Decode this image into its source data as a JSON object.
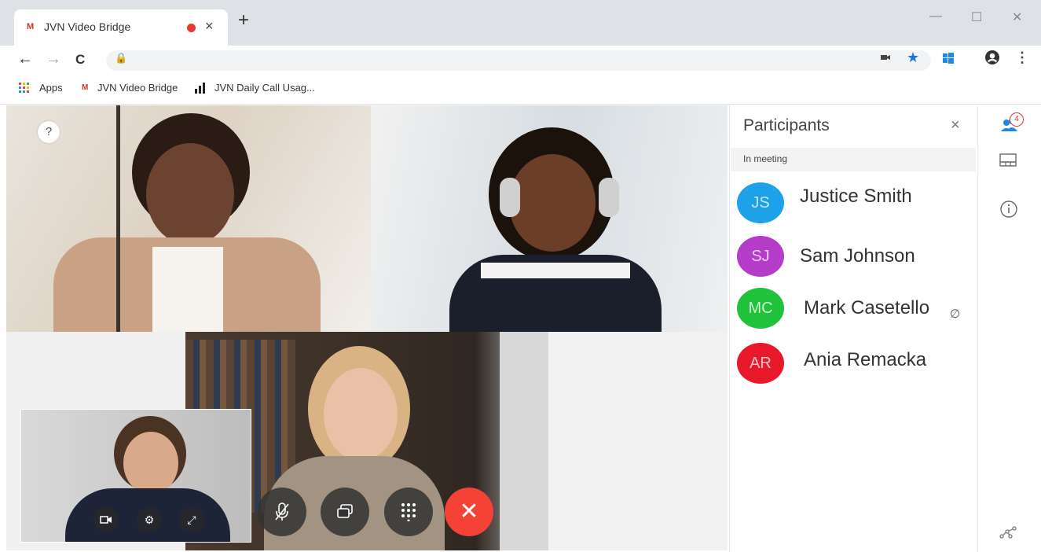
{
  "browser": {
    "tab_title": "JVN Video Bridge",
    "tab_favicon": "M",
    "new_tab": "+",
    "tab_close": "×",
    "window_controls": {
      "minimize": "—",
      "maximize": "☐",
      "close": "✕"
    },
    "nav": {
      "back": "←",
      "forward": "→",
      "reload": "C"
    }
  },
  "bookmarks": {
    "apps": "Apps",
    "items": [
      {
        "label": "JVN Video Bridge",
        "icon": "M"
      },
      {
        "label": "JVN Daily Call Usag...",
        "icon": "bar-chart-icon"
      }
    ]
  },
  "meeting": {
    "help_label": "?",
    "self_controls": [
      "video-icon",
      "settings-icon",
      "expand-icon"
    ],
    "controls": [
      "mic-off-icon",
      "share-screen-icon",
      "keypad-icon",
      "end-call-icon"
    ]
  },
  "participants_panel": {
    "title": "Participants",
    "close": "×",
    "section": "In meeting",
    "people": [
      {
        "initials": "JS",
        "name": "Justice Smith",
        "color": "#1da1e8",
        "muted": false
      },
      {
        "initials": "SJ",
        "name": "Sam Johnson",
        "color": "#b53bc9",
        "muted": false
      },
      {
        "initials": "MC",
        "name": "Mark Casetello",
        "color": "#1fc23a",
        "muted": true
      },
      {
        "initials": "AR",
        "name": "Ania Remacka",
        "color": "#e8192b",
        "muted": false
      }
    ]
  },
  "rail": {
    "participants_badge": "4",
    "icons": [
      "participants-icon",
      "layout-icon",
      "info-icon",
      "network-icon"
    ]
  },
  "colors": {
    "end_call": "#f44336",
    "accent": "#1a73e8"
  }
}
